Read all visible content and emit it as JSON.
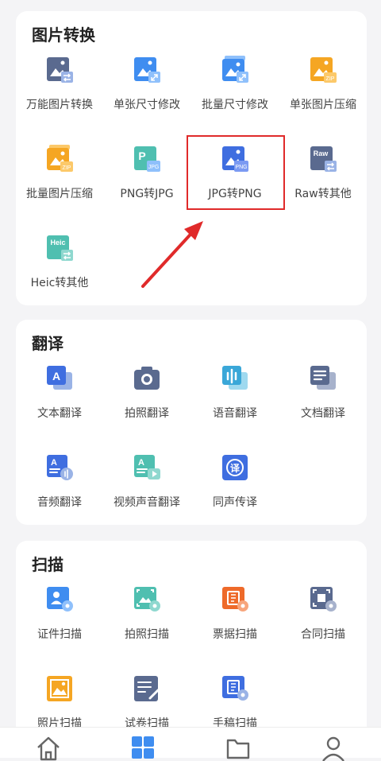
{
  "sections": [
    {
      "title": "图片转换",
      "items": [
        {
          "label": "万能图片转换",
          "icon": "image-convert-icon"
        },
        {
          "label": "单张尺寸修改",
          "icon": "image-resize-icon"
        },
        {
          "label": "批量尺寸修改",
          "icon": "batch-resize-icon"
        },
        {
          "label": "单张图片压缩",
          "icon": "image-zip-icon"
        },
        {
          "label": "批量图片压缩",
          "icon": "batch-zip-icon"
        },
        {
          "label": "PNG转JPG",
          "icon": "png-to-jpg-icon"
        },
        {
          "label": "JPG转PNG",
          "icon": "jpg-to-png-icon"
        },
        {
          "label": "Raw转其他",
          "icon": "raw-convert-icon"
        },
        {
          "label": "Heic转其他",
          "icon": "heic-convert-icon"
        }
      ]
    },
    {
      "title": "翻译",
      "items": [
        {
          "label": "文本翻译",
          "icon": "text-translate-icon"
        },
        {
          "label": "拍照翻译",
          "icon": "camera-translate-icon"
        },
        {
          "label": "语音翻译",
          "icon": "voice-translate-icon"
        },
        {
          "label": "文档翻译",
          "icon": "document-translate-icon"
        },
        {
          "label": "音频翻译",
          "icon": "audio-translate-icon"
        },
        {
          "label": "视频声音翻译",
          "icon": "video-translate-icon"
        },
        {
          "label": "同声传译",
          "icon": "simultaneous-translate-icon"
        }
      ]
    },
    {
      "title": "扫描",
      "items": [
        {
          "label": "证件扫描",
          "icon": "id-scan-icon"
        },
        {
          "label": "拍照扫描",
          "icon": "photo-scan-icon"
        },
        {
          "label": "票据扫描",
          "icon": "receipt-scan-icon"
        },
        {
          "label": "合同扫描",
          "icon": "contract-scan-icon"
        },
        {
          "label": "照片扫描",
          "icon": "picture-scan-icon"
        },
        {
          "label": "试卷扫描",
          "icon": "exam-scan-icon"
        },
        {
          "label": "手稿扫描",
          "icon": "manuscript-scan-icon"
        }
      ]
    }
  ],
  "icon_badges": {
    "zip": "ZIP",
    "jpg": "JPG",
    "png": "PNG",
    "raw": "Raw",
    "heic": "Heic",
    "p": "P",
    "a": "A",
    "yi": "译"
  },
  "tabs": [
    {
      "name": "home-icon"
    },
    {
      "name": "tools-grid-icon",
      "active": true
    },
    {
      "name": "folder-icon"
    },
    {
      "name": "profile-icon"
    }
  ],
  "colors": {
    "blue": "#3f8df0",
    "slate": "#5a6a8f",
    "orange": "#f5a623",
    "teal": "#4fbfb0",
    "highlight": "#e02a2a",
    "tab_active": "#3f8df0"
  }
}
